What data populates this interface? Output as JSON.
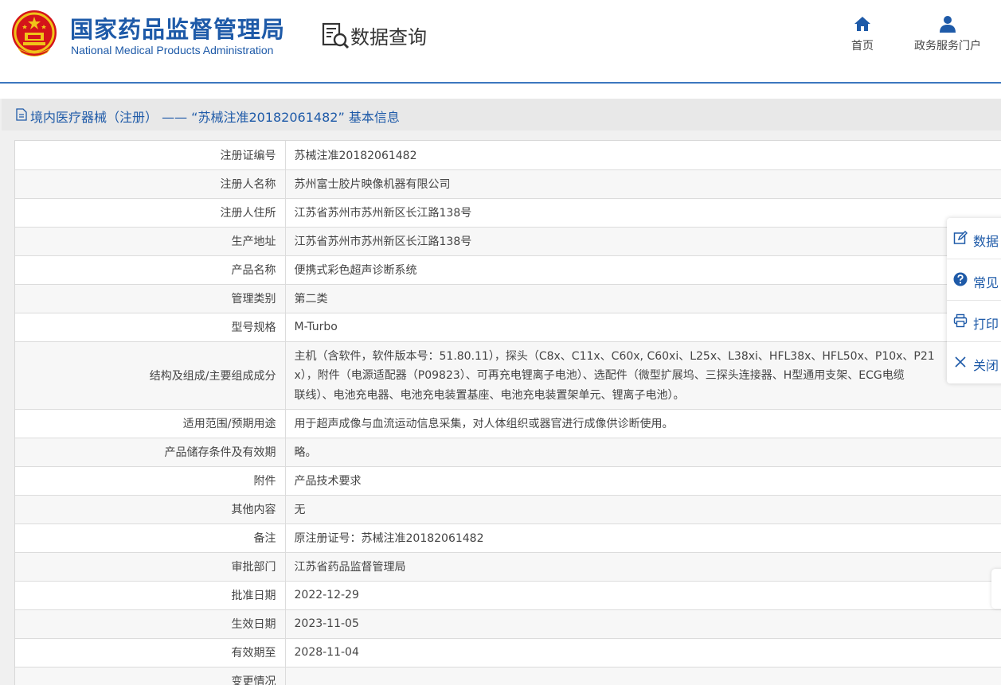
{
  "header": {
    "logo_cn": "国家药品监督管理局",
    "logo_en": "National Medical Products Administration",
    "query_label": "数据查询",
    "nav": [
      {
        "label": "首页",
        "icon": "home-icon"
      },
      {
        "label": "政务服务门户",
        "icon": "user-icon"
      }
    ]
  },
  "section": {
    "title": "境内医疗器械（注册） —— “苏械注准20182061482” 基本信息"
  },
  "table": {
    "rows": [
      {
        "label": "注册证编号",
        "value": "苏械注准20182061482"
      },
      {
        "label": "注册人名称",
        "value": "苏州富士胶片映像机器有限公司"
      },
      {
        "label": "注册人住所",
        "value": "江苏省苏州市苏州新区长江路138号"
      },
      {
        "label": "生产地址",
        "value": "江苏省苏州市苏州新区长江路138号"
      },
      {
        "label": "产品名称",
        "value": "便携式彩色超声诊断系统"
      },
      {
        "label": "管理类别",
        "value": "第二类"
      },
      {
        "label": "型号规格",
        "value": "M-Turbo"
      },
      {
        "label": "结构及组成/主要组成成分",
        "value_lines": [
          "主机（含软件，软件版本号：51.80.11），探头（C8x、C11x、C60x, C60xi、L25x、L38xi、HFL38x、HFL50x、P10x、P21",
          "x），附件（电源适配器（P09823）、可再充电锂离子电池）、选配件（微型扩展坞、三探头连接器、H型通用支架、ECG电缆",
          "联线）、电池充电器、电池充电装置基座、电池充电装置架单元、锂离子电池）。"
        ]
      },
      {
        "label": "适用范围/预期用途",
        "value": "用于超声成像与血流运动信息采集，对人体组织或器官进行成像供诊断使用。"
      },
      {
        "label": "产品储存条件及有效期",
        "value": "略。"
      },
      {
        "label": "附件",
        "value": "产品技术要求"
      },
      {
        "label": "其他内容",
        "value": "无"
      },
      {
        "label": "备注",
        "value": "原注册证号：苏械注准20182061482"
      },
      {
        "label": "审批部门",
        "value": "江苏省药品监督管理局"
      },
      {
        "label": "批准日期",
        "value": "2022-12-29"
      },
      {
        "label": "生效日期",
        "value": "2023-11-05"
      },
      {
        "label": "有效期至",
        "value": "2028-11-04"
      },
      {
        "label": "变更情况",
        "value": ""
      }
    ]
  },
  "float_tools": [
    {
      "label": "数据",
      "icon": "edit-icon"
    },
    {
      "label": "常见",
      "icon": "help-icon"
    },
    {
      "label": "打印",
      "icon": "print-icon"
    },
    {
      "label": "关闭",
      "icon": "close-icon"
    }
  ],
  "colors": {
    "brand": "#1e5aa8",
    "emblem_red": "#d4141a",
    "emblem_gold": "#f0c419"
  }
}
